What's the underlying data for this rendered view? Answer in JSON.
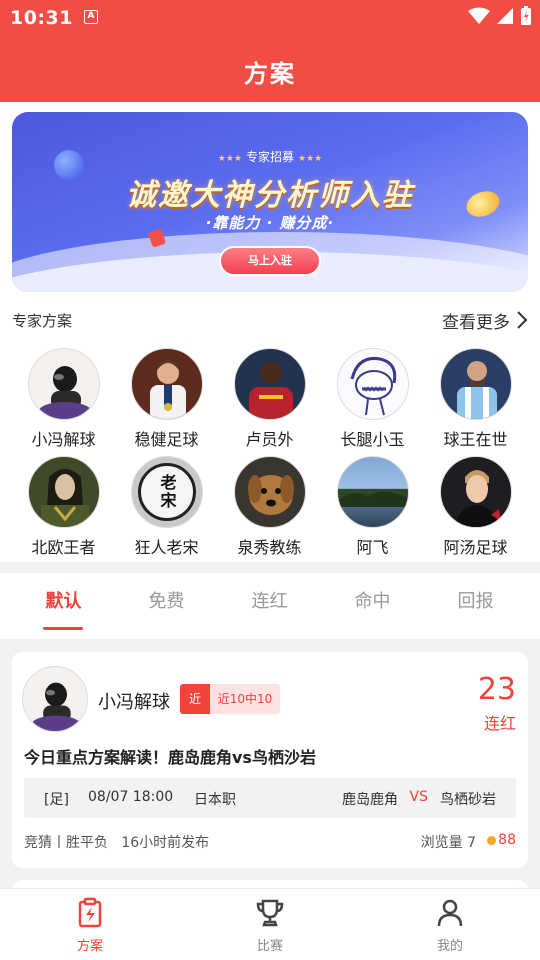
{
  "status_bar": {
    "time": "10:31",
    "app_badge": "A"
  },
  "header": {
    "title": "方案"
  },
  "banner": {
    "subtitle": "专家招募",
    "title": "诚邀大神分析师入驻",
    "tagline": "·靠能力 · 赚分成·",
    "button_label": "马上入驻"
  },
  "experts": {
    "section_title": "专家方案",
    "more_label": "查看更多",
    "items": [
      {
        "name": "小冯解球"
      },
      {
        "name": "稳健足球"
      },
      {
        "name": "卢员外"
      },
      {
        "name": "长腿小玉"
      },
      {
        "name": "球王在世"
      },
      {
        "name": "北欧王者"
      },
      {
        "name": "狂人老宋",
        "avatar_text": "老宋"
      },
      {
        "name": "泉秀教练"
      },
      {
        "name": "阿飞"
      },
      {
        "name": "阿汤足球"
      }
    ]
  },
  "tabs": [
    {
      "label": "默认",
      "active": true
    },
    {
      "label": "免费",
      "active": false
    },
    {
      "label": "连红",
      "active": false
    },
    {
      "label": "命中",
      "active": false
    },
    {
      "label": "回报",
      "active": false
    }
  ],
  "card": {
    "author": "小冯解球",
    "badge_near": "近",
    "badge_record": "近10中10",
    "streak_count": "23",
    "streak_label": "连红",
    "headline": "今日重点方案解读！鹿岛鹿角vs鸟栖沙岩",
    "match": {
      "league": "[足]",
      "time": "08/07 18:00",
      "competition": "日本职",
      "home": "鹿岛鹿角",
      "vs": "VS",
      "away": "鸟栖砂岩"
    },
    "meta": "竞猜丨胜平负   16小时前发布",
    "views": "浏览量 7",
    "price": "88"
  },
  "bottom_nav": [
    {
      "label": "方案",
      "active": true,
      "icon": "plan-icon"
    },
    {
      "label": "比赛",
      "active": false,
      "icon": "trophy-icon"
    },
    {
      "label": "我的",
      "active": false,
      "icon": "person-icon"
    }
  ],
  "colors": {
    "primary_red": "#f24d45",
    "accent_red": "#f0433c",
    "banner_blue": "#5a6cf0"
  }
}
